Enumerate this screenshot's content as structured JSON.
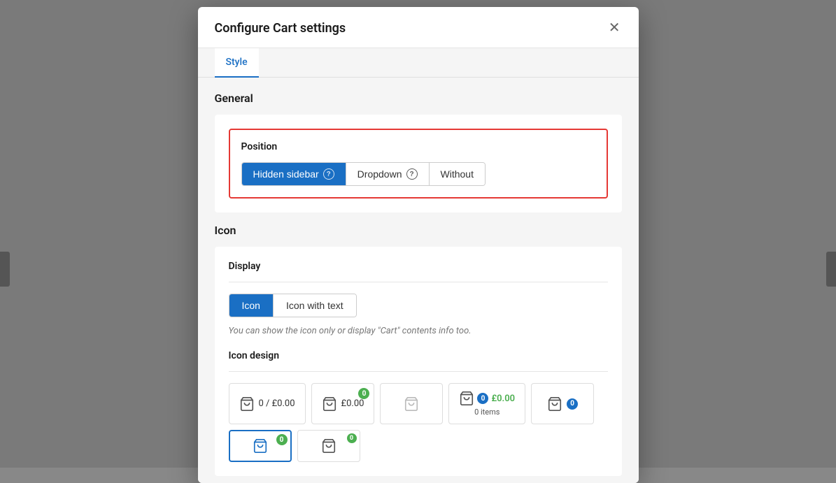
{
  "modal": {
    "title": "Configure Cart settings",
    "close_label": "×",
    "tabs": [
      {
        "id": "style",
        "label": "Style",
        "active": true
      }
    ]
  },
  "general": {
    "section_title": "General",
    "position": {
      "label": "Position",
      "options": [
        {
          "id": "hidden_sidebar",
          "label": "Hidden sidebar",
          "active": true,
          "has_help": true
        },
        {
          "id": "dropdown",
          "label": "Dropdown",
          "active": false,
          "has_help": true
        },
        {
          "id": "without",
          "label": "Without",
          "active": false,
          "has_help": false
        }
      ]
    }
  },
  "icon": {
    "section_title": "Icon",
    "display": {
      "label": "Display",
      "options": [
        {
          "id": "icon",
          "label": "Icon",
          "active": true
        },
        {
          "id": "icon_with_text",
          "label": "Icon with text",
          "active": false
        }
      ]
    },
    "hint": "You can show the icon only or display \"Cart\" contents info too.",
    "design_label": "Icon design",
    "designs": [
      {
        "id": "design1",
        "counter": "0 / £0.00",
        "badge": null,
        "selected": false,
        "style": "text"
      },
      {
        "id": "design2",
        "counter": "£0.00",
        "badge": "0",
        "badge_color": "green",
        "selected": false,
        "style": "badge_icon"
      },
      {
        "id": "design3",
        "counter": "",
        "badge": null,
        "selected": false,
        "style": "light"
      },
      {
        "id": "design4",
        "counter": "£0.00\n0 items",
        "badge": "0",
        "badge_color": "green",
        "selected": false,
        "style": "text_below"
      },
      {
        "id": "design5",
        "counter": "0",
        "badge": null,
        "selected": false,
        "style": "inline_badge",
        "badge_inline": true
      },
      {
        "id": "design6",
        "counter": "0",
        "badge": "0",
        "badge_color": "blue",
        "selected": true,
        "style": "selected"
      },
      {
        "id": "design7",
        "counter": "0",
        "badge": "0",
        "badge_color": "green_corner",
        "selected": false,
        "style": "corner"
      }
    ]
  }
}
